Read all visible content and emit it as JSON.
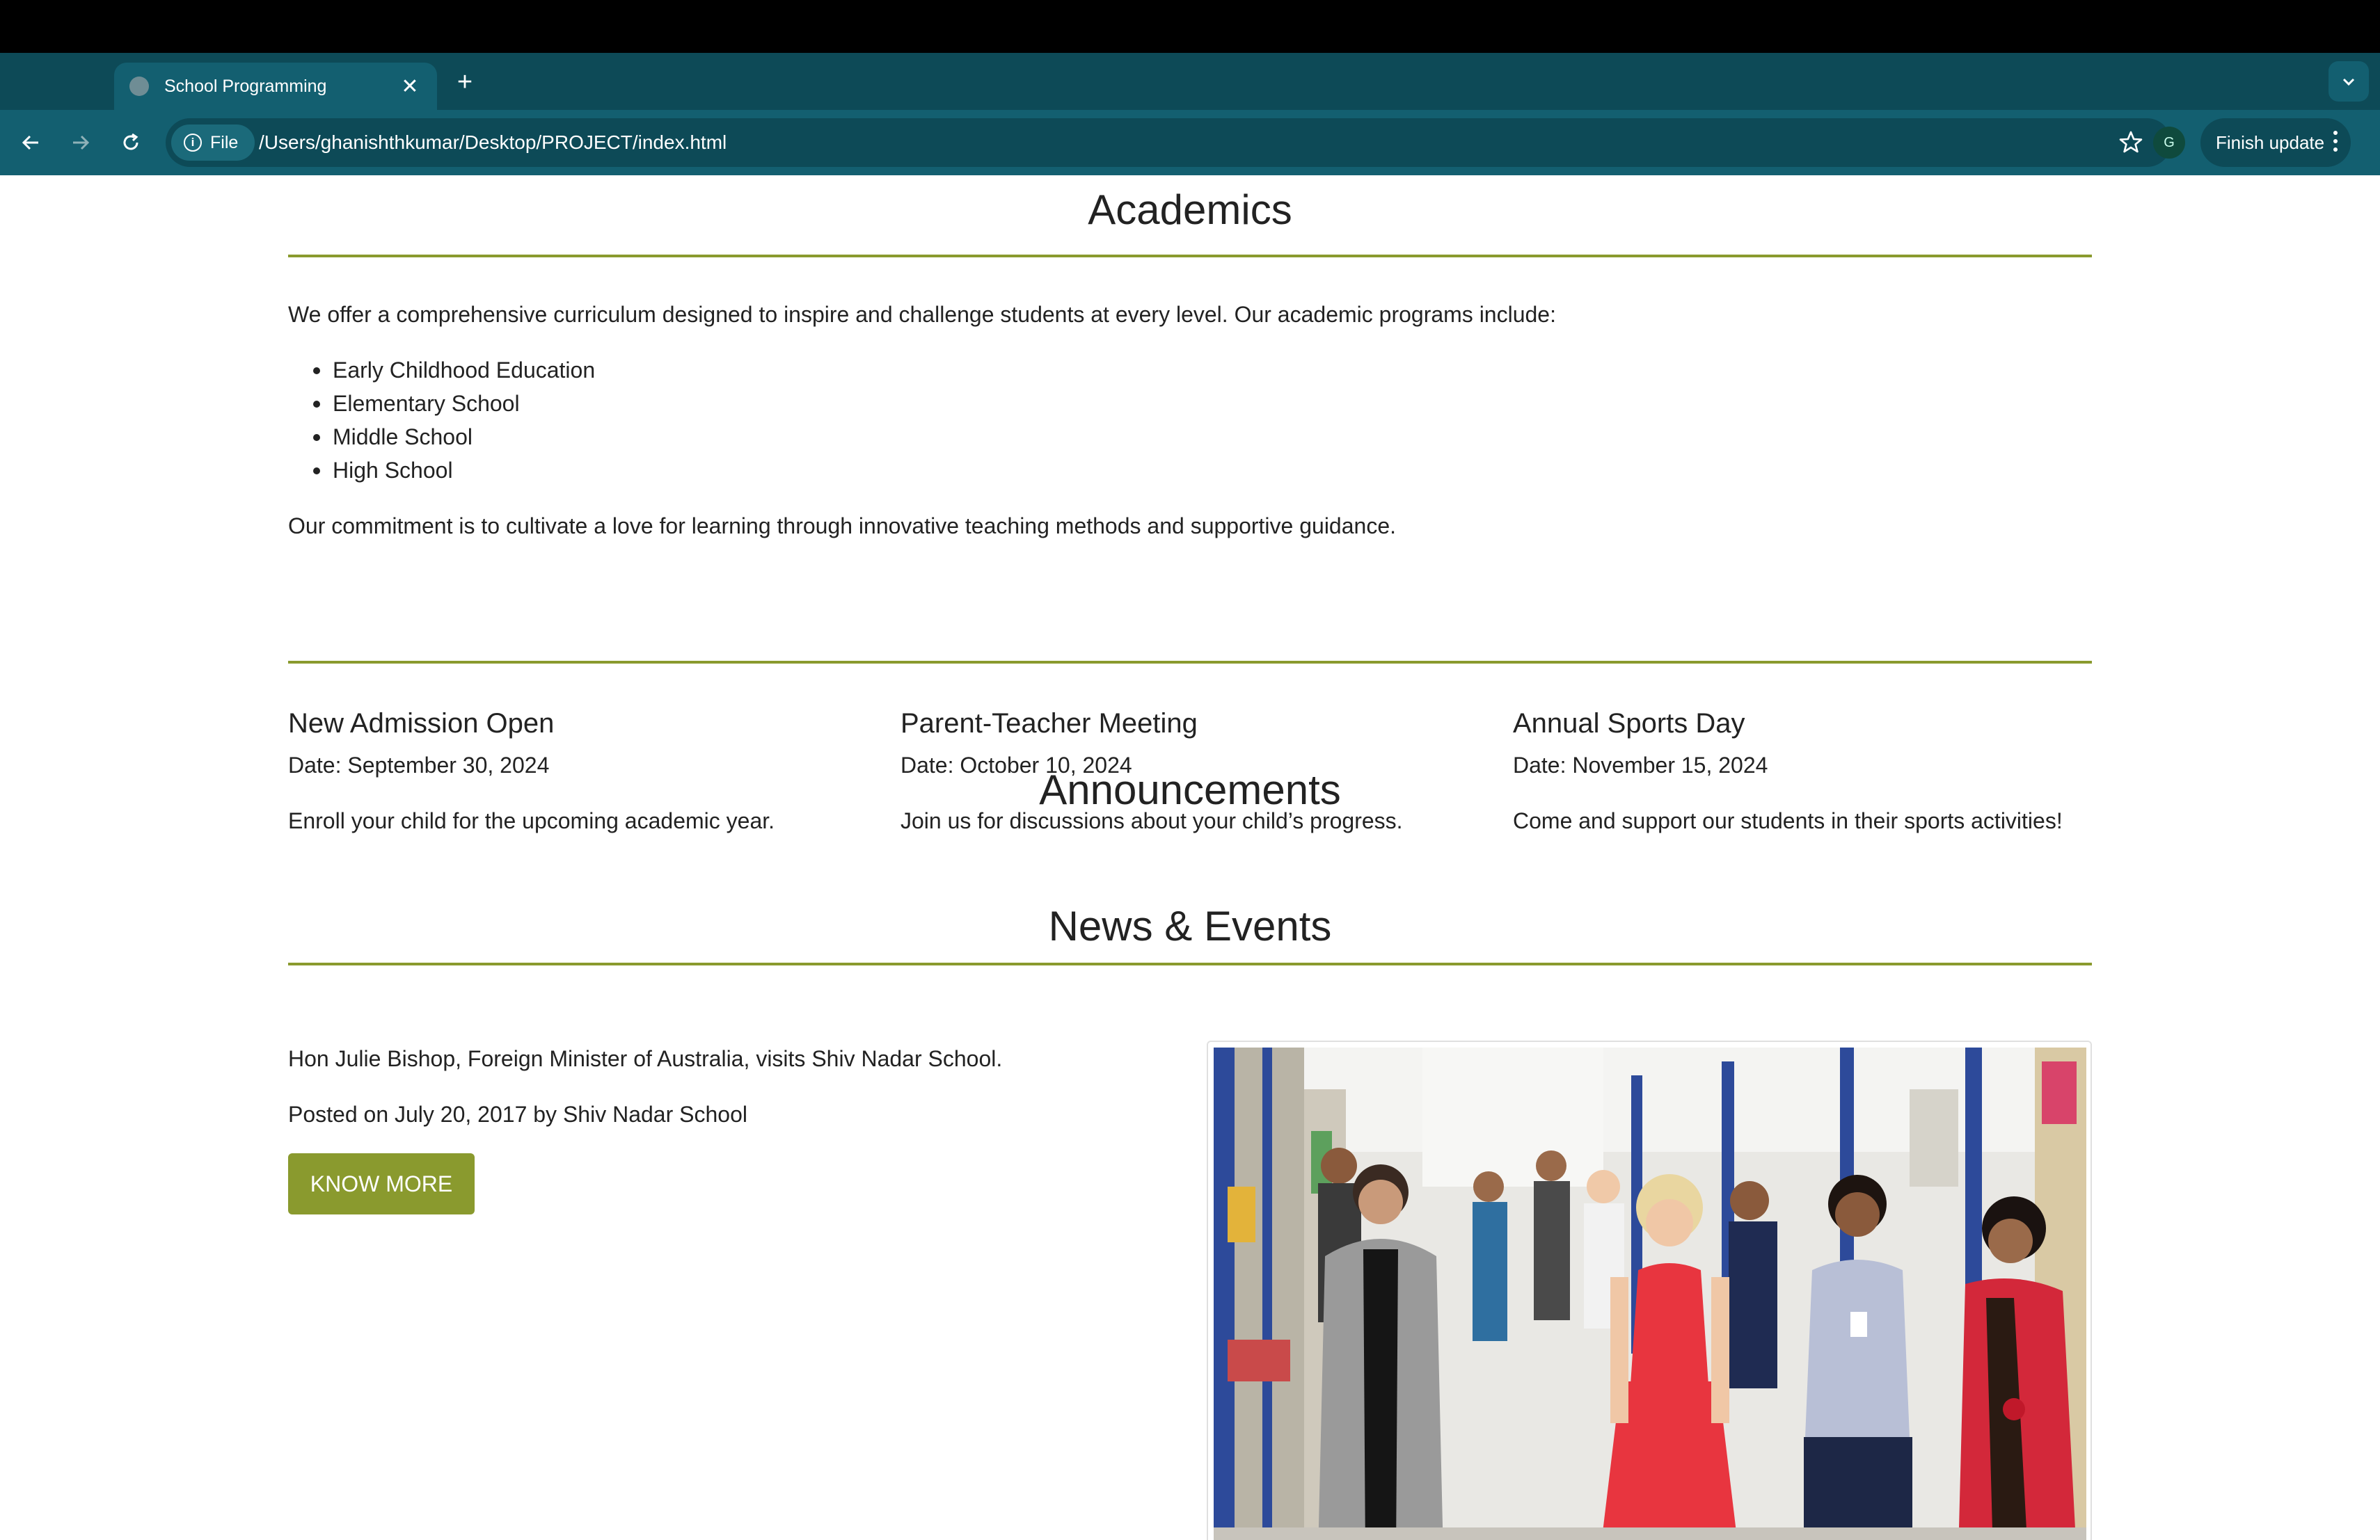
{
  "browser": {
    "tab_title": "School Programming",
    "omnibox_chip": "File",
    "url": "/Users/ghanishthkumar/Desktop/PROJECT/index.html",
    "profile_initial": "G",
    "update_label": "Finish update"
  },
  "academics": {
    "heading": "Academics",
    "intro": "We offer a comprehensive curriculum designed to inspire and challenge students at every level. Our academic programs include:",
    "programs": [
      "Early Childhood Education",
      "Elementary School",
      "Middle School",
      "High School"
    ],
    "closing": "Our commitment is to cultivate a love for learning through innovative teaching methods and supportive guidance."
  },
  "announcements": {
    "heading": "Announcements",
    "items": [
      {
        "title": "New Admission Open",
        "date": "Date: September 30, 2024",
        "desc": "Enroll your child for the upcoming academic year."
      },
      {
        "title": "Parent-Teacher Meeting",
        "date": "Date: October 10, 2024",
        "desc": "Join us for discussions about your child’s progress."
      },
      {
        "title": "Annual Sports Day",
        "date": "Date: November 15, 2024",
        "desc": "Come and support our students in their sports activities!"
      }
    ]
  },
  "news": {
    "heading": "News & Events",
    "headline": "Hon Julie Bishop, Foreign Minister of Australia, visits Shiv Nadar School.",
    "posted": "Posted on July 20, 2017 by Shiv Nadar School",
    "button_label": "KNOW MORE"
  },
  "colors": {
    "accent": "#8a9a2e",
    "chrome_dark": "#0d4a57",
    "chrome_light": "#135f70"
  }
}
